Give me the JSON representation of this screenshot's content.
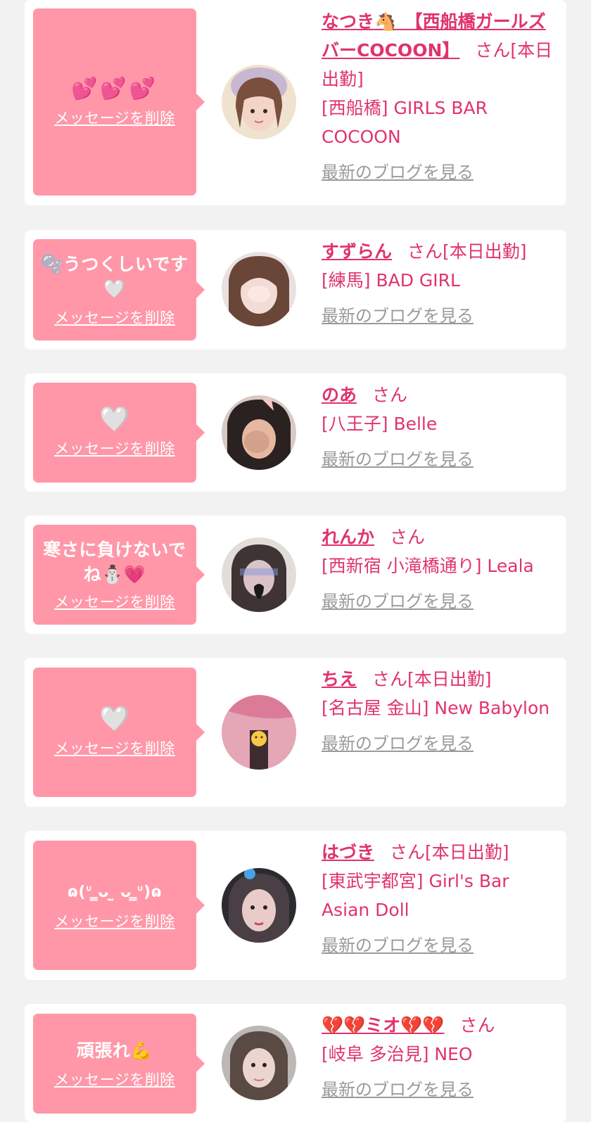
{
  "delete_label": "メッセージを削除",
  "blog_label": "最新のブログを見る",
  "san_label": "さん",
  "colors": {
    "accent": "#e0336c",
    "bubble": "#ff97a8",
    "bg": "#f2f2f2"
  },
  "entries": [
    {
      "message": "💕💕💕",
      "name": "なつき🐴　【西船橋ガールズバーCOCOON】",
      "status": "[本日出勤]",
      "shop": "[西船橋] GIRLS BAR COCOON"
    },
    {
      "message": "🫧うつくしいです🤍",
      "name": "すずらん",
      "status": "[本日出勤]",
      "shop": "[練馬] BAD GIRL"
    },
    {
      "message": "🤍",
      "name": "のあ",
      "status": "",
      "shop": "[八王子] Belle"
    },
    {
      "message": "寒さに負けないでね⛄💗",
      "name": "れんか",
      "status": "",
      "shop": "[西新宿 小滝橋通り] Leala"
    },
    {
      "message": "🤍",
      "name": "ちえ",
      "status": "[本日出勤]",
      "shop": "[名古屋 金山] New Babylon"
    },
    {
      "message": "ɷ(ᐡ ̳ᴗ ̫ ᴗ ̳ᐡ)ɷ",
      "name": "はづき",
      "status": "[本日出勤]",
      "shop": "[東武宇都宮] Girl's Bar Asian Doll"
    },
    {
      "message": "頑張れ💪",
      "name": "💔💔ミオ💔💔",
      "status": "",
      "shop": "[岐阜 多治見] NEO"
    }
  ]
}
